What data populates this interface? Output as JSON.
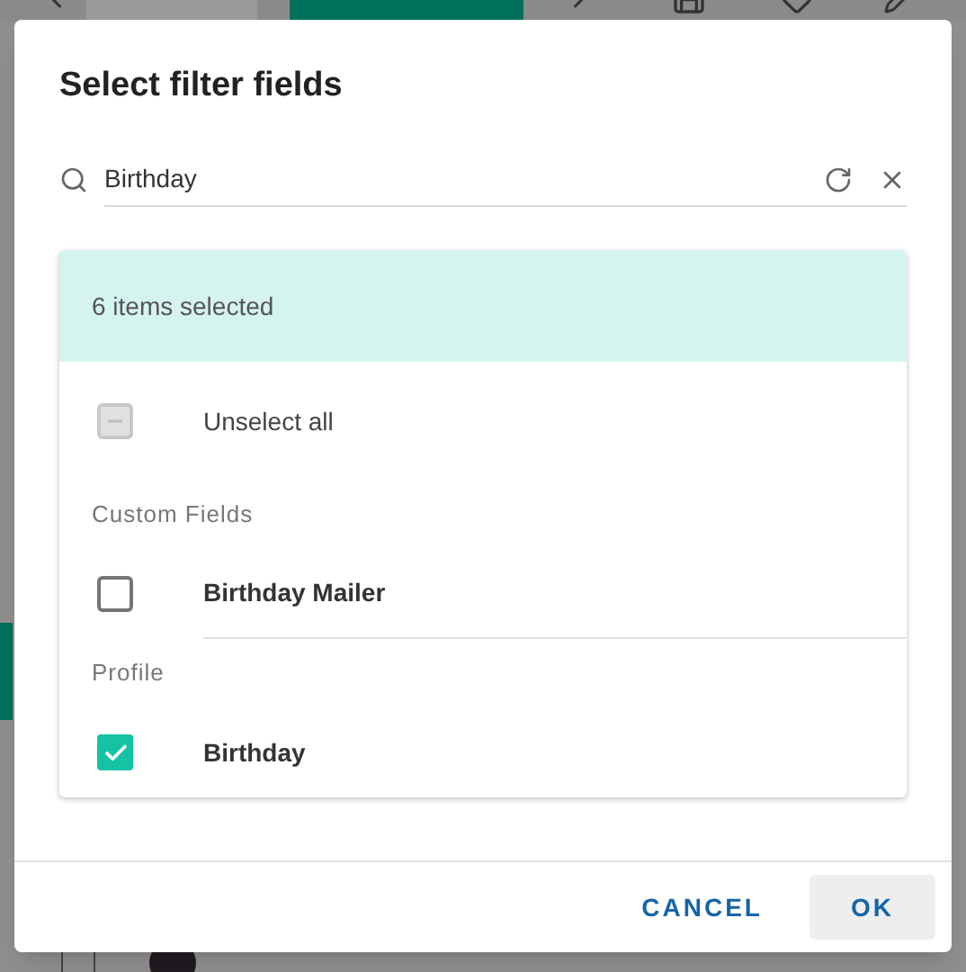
{
  "background": {
    "tabs": [
      {
        "selected": false
      },
      {
        "selected": true
      }
    ]
  },
  "dialog": {
    "title": "Select filter fields",
    "search": {
      "value": "Birthday"
    },
    "summary": "6 items selected",
    "select_all": {
      "label": "Unselect all",
      "checked": false,
      "indeterminate": true
    },
    "groups": [
      {
        "heading": "Custom Fields",
        "items": [
          {
            "label": "Birthday Mailer",
            "checked": false
          }
        ]
      },
      {
        "heading": "Profile",
        "items": [
          {
            "label": "Birthday",
            "checked": true
          }
        ]
      }
    ],
    "buttons": [
      {
        "label": "CANCEL",
        "kind": "text"
      },
      {
        "label": "OK",
        "kind": "hovered"
      }
    ]
  }
}
